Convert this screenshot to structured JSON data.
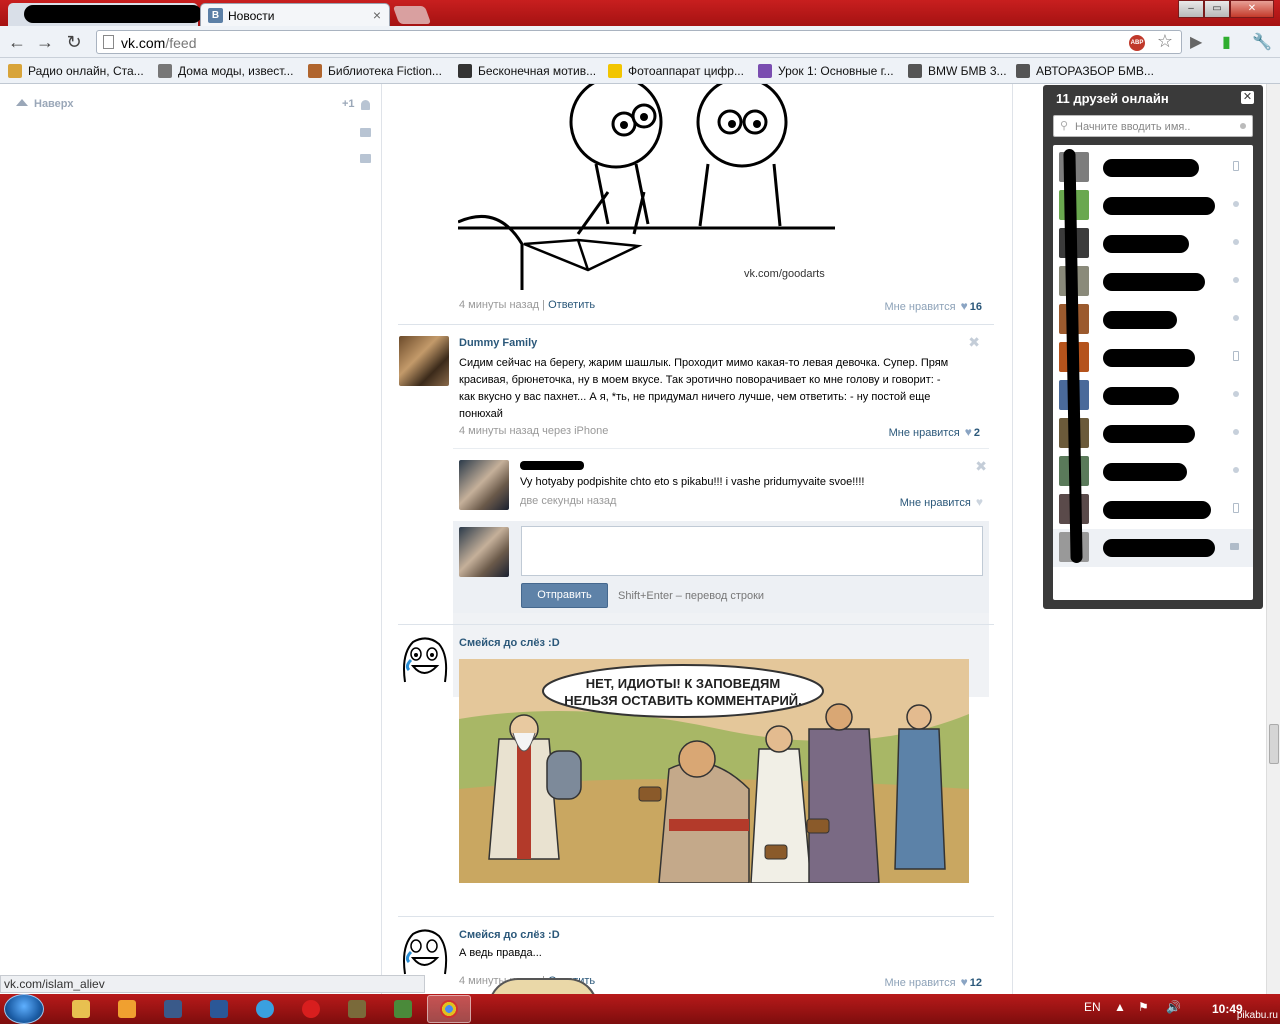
{
  "browser": {
    "tab_title": "Новости",
    "tab_icon_letter": "В",
    "url_domain": "vk.com",
    "url_path": "/feed",
    "abp_label": "ABP"
  },
  "bookmarks": [
    {
      "label": "Радио онлайн, Ста...",
      "icon": "radio-icon",
      "color": "#d8a43a"
    },
    {
      "label": "Дома моды, извест...",
      "icon": "fashion-icon",
      "color": "#777777"
    },
    {
      "label": "Библиотека Fiction...",
      "icon": "library-icon",
      "color": "#b0652e"
    },
    {
      "label": "Бесконечная мотив...",
      "icon": "hourglass-icon",
      "color": "#333333"
    },
    {
      "label": "Фотоаппарат цифр...",
      "icon": "a-letter-icon",
      "color": "#f2c500"
    },
    {
      "label": "Урок 1: Основные г...",
      "icon": "lesson-icon",
      "color": "#7a4db0"
    },
    {
      "label": "BMW БМВ 3...",
      "icon": "bmw-icon",
      "color": "#555555"
    },
    {
      "label": "АВТОРАЗБОР БМВ...",
      "icon": "bmw-icon",
      "color": "#555555"
    }
  ],
  "left": {
    "to_top": "Наверх",
    "plus_one": "+1"
  },
  "post1": {
    "watermark": "vk.com/goodarts",
    "time": "4 минуты назад",
    "reply": "Ответить",
    "like_label": "Мне нравится",
    "like_count": "16"
  },
  "post2": {
    "author": "Dummy Family",
    "text": "Сидим сейчас на берегу, жарим шашлык. Проходит мимо какая-то левая девочка. Супер. Прям красивая, брюнеточка, ну в моем вкусе. Так эротично поворачивает ко мне голову и говорит: - как вкусно у вас пахнет... А я, *ть, не придумал ничего лучше, чем ответить: - ну постой еще понюхай",
    "time": "4 минуты назад через iPhone",
    "like_label": "Мне нравится",
    "like_count": "2",
    "comment": {
      "text": "Vy hotyaby podpishite chto eto s pikabu!!! i vashe pridumyvaite svoe!!!!",
      "time": "две секунды назад",
      "like_label": "Мне нравится"
    },
    "send_label": "Отправить",
    "send_hint": "Shift+Enter – перевод строки"
  },
  "post3": {
    "author": "Смейся до слёз :D",
    "bubble_line1": "НЕТ, ИДИОТЫ! К ЗАПОВЕДЯМ",
    "bubble_line2": "НЕЛЬЗЯ ОСТАВИТЬ КОММЕНТАРИЙ.",
    "time": "4 минуты назад",
    "reply": "Ответить",
    "like_label": "Мне нравится",
    "like_count": "12"
  },
  "post4": {
    "author": "Смейся до слёз :D",
    "text": "А ведь правда..."
  },
  "chat": {
    "title": "11 друзей онлайн",
    "search_placeholder": "Начните вводить имя..",
    "items": [
      {
        "status": "phone",
        "color": "#7d7d7d"
      },
      {
        "status": "online",
        "color": "#6aa84f"
      },
      {
        "status": "online",
        "color": "#3b3b3b"
      },
      {
        "status": "online",
        "color": "#8a8a7a"
      },
      {
        "status": "online",
        "color": "#9b5a2e"
      },
      {
        "status": "phone",
        "color": "#b5531c"
      },
      {
        "status": "online",
        "color": "#4a6a9a"
      },
      {
        "status": "online",
        "color": "#6b5a3a"
      },
      {
        "status": "online",
        "color": "#5a7a5a"
      },
      {
        "status": "phone",
        "color": "#5a4a4a"
      },
      {
        "status": "message",
        "color": "#999999"
      }
    ]
  },
  "status_bar": {
    "link": "vk.com/islam_aliev"
  },
  "taskbar": {
    "lang": "EN",
    "time": "10:49",
    "watermark": "pikabu.ru"
  }
}
